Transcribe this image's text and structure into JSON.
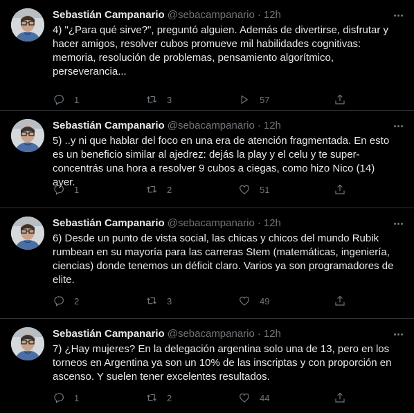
{
  "tweets": [
    {
      "name": "Sebastián Campanario",
      "handle": "@sebacampanario",
      "dot": "·",
      "time": "12h",
      "text": "4) \"¿Para qué sirve?\", preguntó alguien. Además de divertirse, disfrutar y hacer amigos, resolver cubos promueve mil habilidades cognitivas: memoria, resolución de problemas, pensamiento algorítmico, perseverancia...",
      "replies": "1",
      "retweets": "3",
      "likes": "57"
    },
    {
      "name": "Sebastián Campanario",
      "handle": "@sebacampanario",
      "dot": "·",
      "time": "12h",
      "text": "5) ..y ni que hablar del foco en una era de atención fragmentada. En esto es un beneficio similar al ajedrez: dejás la play y el celu y te super-concentrás una hora a resolver 9 cubos a ciegas, como hizo Nico (14) ayer.",
      "replies": "1",
      "retweets": "2",
      "likes": "51"
    },
    {
      "name": "Sebastián Campanario",
      "handle": "@sebacampanario",
      "dot": "·",
      "time": "12h",
      "text": "6) Desde un punto de vista social, las chicas y chicos del mundo Rubik rumbean en su mayoría para las carreras Stem (matemáticas, ingeniería, ciencias) donde tenemos un déficit claro. Varios ya son programadores de elite.",
      "replies": "2",
      "retweets": "3",
      "likes": "49"
    },
    {
      "name": "Sebastián Campanario",
      "handle": "@sebacampanario",
      "dot": "·",
      "time": "12h",
      "text": "7) ¿Hay mujeres? En la delegación argentina solo una de 13, pero en los torneos en Argentina ya son un 10% de las inscriptas y con proporción en ascenso. Y suelen tener excelentes resultados.",
      "replies": "1",
      "retweets": "2",
      "likes": "44"
    }
  ],
  "icons": {
    "more": "more-icon",
    "reply": "reply-icon",
    "retweet": "retweet-icon",
    "like": "like-icon",
    "views": "views-icon",
    "share": "share-icon"
  },
  "colors": {
    "background": "#000000",
    "text": "#e7e9ea",
    "secondary": "#71767b",
    "divider": "#2f3336"
  }
}
